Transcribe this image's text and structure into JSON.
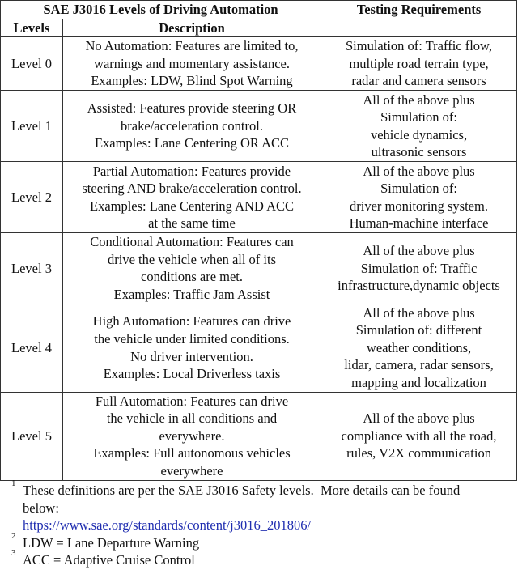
{
  "table": {
    "header_group": {
      "levels_group": "SAE J3016 Levels of Driving Automation",
      "testing": "Testing Requirements"
    },
    "header": {
      "levels": "Levels",
      "description": "Description",
      "testing": ""
    },
    "rows": [
      {
        "level": "Level 0",
        "description": [
          "No Automation: Features are limited to,",
          "warnings and momentary assistance.",
          "Examples: LDW, Blind Spot Warning"
        ],
        "testing": [
          "Simulation of: Traffic flow,",
          "multiple road terrain type,",
          "radar and camera sensors"
        ]
      },
      {
        "level": "Level 1",
        "description": [
          "Assisted: Features provide steering OR",
          "brake/acceleration control.",
          "Examples: Lane Centering OR ACC"
        ],
        "testing": [
          "All of the above plus",
          "Simulation of:",
          "vehicle dynamics,",
          "ultrasonic sensors"
        ]
      },
      {
        "level": "Level 2",
        "description": [
          "Partial Automation: Features provide",
          "steering AND brake/acceleration control.",
          "Examples: Lane Centering AND ACC",
          "at the same time"
        ],
        "testing": [
          "All of the above plus",
          "Simulation of:",
          "driver monitoring system.",
          "Human-machine interface"
        ]
      },
      {
        "level": "Level 3",
        "description": [
          "Conditional Automation: Features can",
          "drive the vehicle when all of its",
          "conditions are met.",
          "Examples: Traffic Jam Assist"
        ],
        "testing": [
          "All of the above plus",
          "Simulation of: Traffic",
          "infrastructure,dynamic objects"
        ]
      },
      {
        "level": "Level 4",
        "description": [
          "High Automation: Features can drive",
          "the vehicle under limited conditions.",
          "No driver intervention.",
          "Examples: Local Driverless taxis"
        ],
        "testing": [
          "All of the above plus",
          "Simulation of: different",
          "weather conditions,",
          "lidar, camera, radar sensors,",
          "mapping and localization"
        ]
      },
      {
        "level": "Level 5",
        "description": [
          "Full Automation: Features can drive",
          "the vehicle in all conditions and",
          "everywhere.",
          "Examples: Full autonomous vehicles",
          "everywhere"
        ],
        "testing": [
          "All of the above plus",
          "compliance with all the road,",
          "rules, V2X communication"
        ]
      }
    ]
  },
  "footnotes": [
    {
      "mark": "1",
      "lines": [
        "These definitions are per the SAE J3016 Safety levels.  More details can be found",
        "below:"
      ],
      "link": "https://www.sae.org/standards/content/j3016_201806/"
    },
    {
      "mark": "2",
      "lines": [
        "LDW = Lane Departure Warning"
      ]
    },
    {
      "mark": "3",
      "lines": [
        "ACC = Adaptive Cruise Control"
      ]
    }
  ],
  "colors": {
    "link": "#1f2db0",
    "border": "#333333",
    "text": "#111111"
  }
}
